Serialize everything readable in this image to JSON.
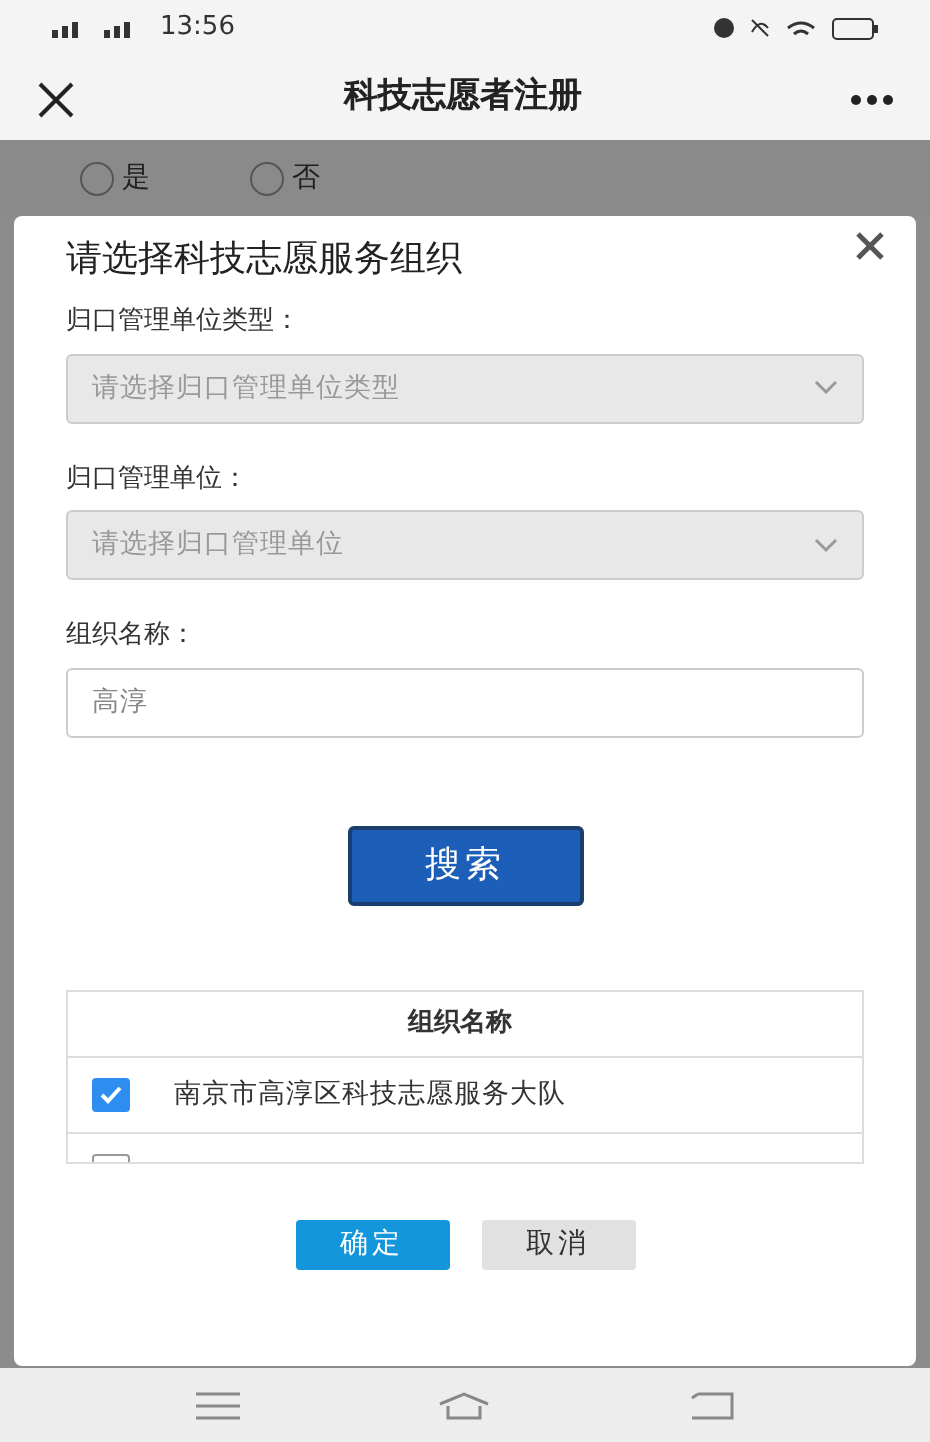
{
  "status_bar": {
    "time": "13:56"
  },
  "header": {
    "title": "科技志愿者注册"
  },
  "background_form": {
    "radios": [
      {
        "label": "是",
        "selected": false
      },
      {
        "label": "否",
        "selected": false
      }
    ]
  },
  "dialog": {
    "title": "请选择科技志愿服务组织",
    "fields": [
      {
        "kind": "select",
        "label": "归口管理单位类型：",
        "placeholder": "请选择归口管理单位类型",
        "disabled": true
      },
      {
        "kind": "select",
        "label": "归口管理单位：",
        "placeholder": "请选择归口管理单位",
        "disabled": true
      },
      {
        "kind": "text",
        "label": "组织名称：",
        "value": "高淳"
      }
    ],
    "search_button": "搜索",
    "table": {
      "columns": [
        "组织名称"
      ],
      "rows": [
        {
          "name": "南京市高淳区科技志愿服务大队",
          "checked": true
        },
        {
          "checked": false
        }
      ]
    },
    "buttons": [
      {
        "label": "确定",
        "kind": "primary"
      },
      {
        "label": "取消",
        "kind": "secondary"
      }
    ]
  }
}
